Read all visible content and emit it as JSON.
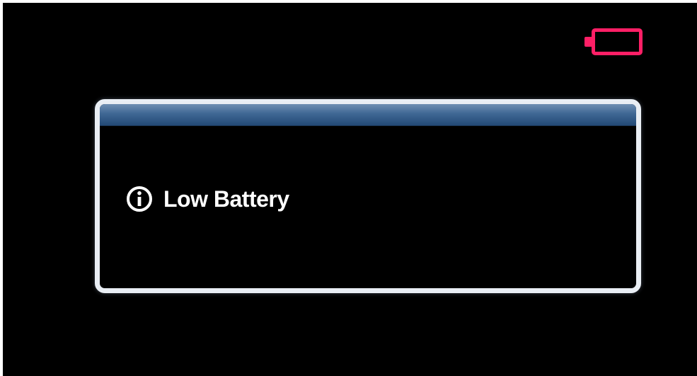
{
  "status_bar": {
    "battery": {
      "icon": "battery-empty-icon",
      "level": 0,
      "color": "#ff1f66"
    }
  },
  "dialog": {
    "icon": "info-icon",
    "message": "Low Battery",
    "header_color": "#3f6794",
    "border_color": "#e9eef4"
  }
}
